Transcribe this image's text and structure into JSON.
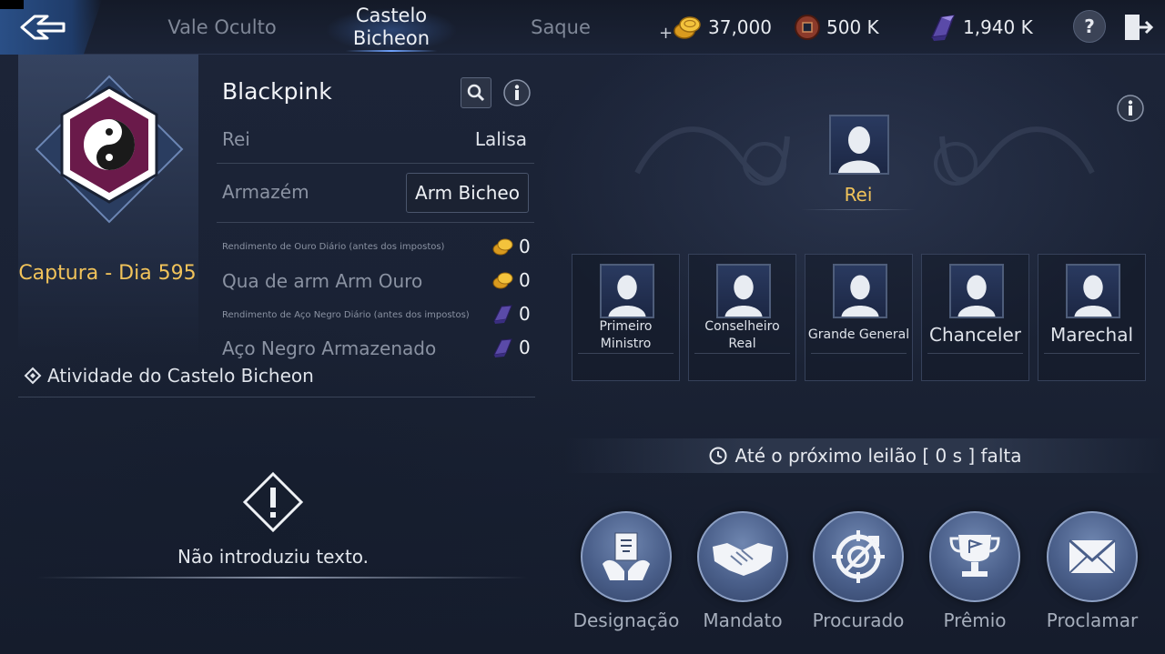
{
  "topbar": {
    "tabs": [
      {
        "label": "Vale Oculto",
        "active": false
      },
      {
        "label": "Castelo\nBicheon",
        "active": true
      },
      {
        "label": "Saque",
        "active": false
      }
    ],
    "currencies": {
      "gold": "37,000",
      "coin": "500 K",
      "black_steel": "1,940 K"
    },
    "help_label": "?"
  },
  "castle": {
    "name": "Blackpink",
    "capture_label": "Captura - Dia 595",
    "king_label": "Rei",
    "king_value": "Lalisa",
    "warehouse_label": "Armazém",
    "warehouse_value": "Arm Bicheo",
    "stats": [
      {
        "label": "Rendimento de Ouro Diário (antes dos impostos)",
        "value": "0",
        "icon": "gold-icon",
        "small": true
      },
      {
        "label": "Qua de arm Arm Ouro",
        "value": "0",
        "icon": "gold-icon",
        "small": false
      },
      {
        "label": "Rendimento de Aço Negro Diário (antes dos impostos)",
        "value": "0",
        "icon": "black-steel-icon",
        "small": true
      },
      {
        "label": "Aço Negro Armazenado",
        "value": "0",
        "icon": "black-steel-icon",
        "small": false
      }
    ],
    "activity_title": "Atividade do Castelo Bicheon",
    "empty_message": "Não introduziu texto."
  },
  "court": {
    "king_title": "Rei",
    "offices": [
      {
        "label": "Primeiro\nMinistro"
      },
      {
        "label": "Conselheiro\nReal"
      },
      {
        "label": "Grande General"
      },
      {
        "label": "Chanceler"
      },
      {
        "label": "Marechal"
      }
    ],
    "auction_text": "Até o próximo leilão [ 0 s ] falta"
  },
  "actions": [
    {
      "label": "Designação",
      "icon": "designation-icon"
    },
    {
      "label": "Mandato",
      "icon": "handshake-icon"
    },
    {
      "label": "Procurado",
      "icon": "target-icon"
    },
    {
      "label": "Prêmio",
      "icon": "trophy-icon"
    },
    {
      "label": "Proclamar",
      "icon": "envelope-icon"
    }
  ],
  "colors": {
    "accent_gold": "#f1c35a",
    "tab_active_glow": "#6ea2ff",
    "background": "#1a2236"
  }
}
